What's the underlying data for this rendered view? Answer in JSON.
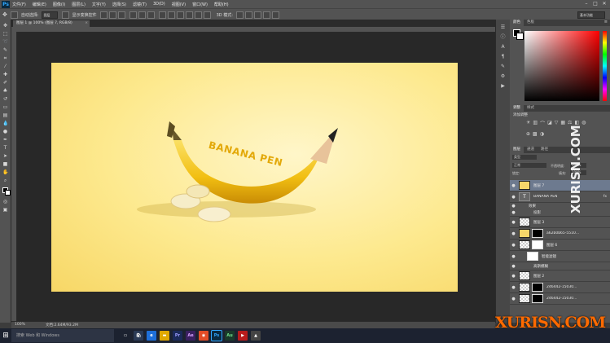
{
  "app": {
    "logo": "Ps"
  },
  "menu": [
    "文件(F)",
    "编辑(E)",
    "图像(I)",
    "图层(L)",
    "文字(Y)",
    "选择(S)",
    "滤镜(T)",
    "3D(D)",
    "视图(V)",
    "窗口(W)",
    "帮助(H)"
  ],
  "options": {
    "auto_select_label": "自动选择:",
    "auto_select_value": "图层",
    "transform_label": "显示变换控件",
    "workspace": "基本功能"
  },
  "document": {
    "tab_title": "图层 1 @ 100% (图层 7, RGB/8)"
  },
  "canvas": {
    "headline": "BANANA PEN"
  },
  "status": {
    "zoom": "100%",
    "doc_info": "文档:2.64M/93.2M"
  },
  "layers_panel": {
    "tabs": [
      "图层",
      "通道",
      "路径"
    ],
    "search_kind": "类型",
    "blend_mode": "正常",
    "opacity_label": "不透明度:",
    "opacity_value": "100%",
    "lock_label": "锁定:",
    "fill_label": "填充:",
    "fill_value": "100%",
    "layers": [
      {
        "name": "图层 7",
        "selected": true
      },
      {
        "name": "BANANA PEN",
        "fx": "fx"
      },
      {
        "name": "效果"
      },
      {
        "name": "投影"
      },
      {
        "name": "图层 3"
      },
      {
        "name": "a62b0b65-5510..."
      },
      {
        "name": "图层 6"
      },
      {
        "name": "智能滤镜"
      },
      {
        "name": "高斯模糊"
      },
      {
        "name": "图层 2"
      },
      {
        "name": "246442-15030..."
      },
      {
        "name": "246442-15030..."
      }
    ]
  },
  "adjustments": {
    "tabs": [
      "调整",
      "样式"
    ],
    "add_label": "添加调整"
  },
  "color_panel": {
    "tabs": [
      "颜色",
      "色板"
    ]
  },
  "taskbar": {
    "search_placeholder": "搜索 Web 和 Windows"
  },
  "watermarks": {
    "main": "XURISN.COM",
    "vertical": "XURISN.COM"
  },
  "colors": {
    "accent": "#31a8ff",
    "panel": "#535353",
    "canvas_bg": "#fde98e",
    "banana": "#f2c21a"
  }
}
